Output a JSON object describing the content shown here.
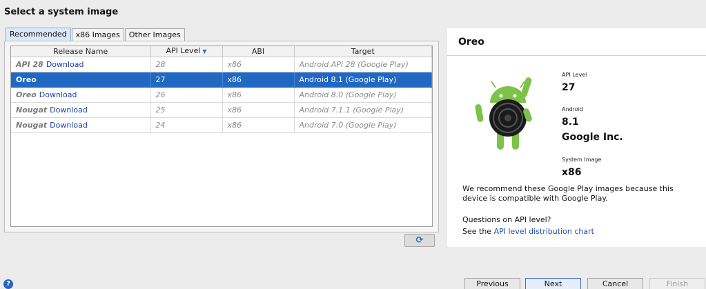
{
  "page": {
    "title": "Select a system image"
  },
  "tabs": [
    {
      "label": "Recommended",
      "active": true
    },
    {
      "label": "x86 Images",
      "active": false
    },
    {
      "label": "Other Images",
      "active": false
    }
  ],
  "table": {
    "columns": [
      "Release Name",
      "API Level",
      "ABI",
      "Target"
    ],
    "sorted_column": "API Level",
    "rows": [
      {
        "name": "API 28",
        "download": "Download",
        "api": "28",
        "abi": "x86",
        "target": "Android API 28 (Google Play)",
        "selected": false
      },
      {
        "name": "Oreo",
        "download": "",
        "api": "27",
        "abi": "x86",
        "target": "Android 8.1 (Google Play)",
        "selected": true
      },
      {
        "name": "Oreo",
        "download": "Download",
        "api": "26",
        "abi": "x86",
        "target": "Android 8.0 (Google Play)",
        "selected": false
      },
      {
        "name": "Nougat",
        "download": "Download",
        "api": "25",
        "abi": "x86",
        "target": "Android 7.1.1 (Google Play)",
        "selected": false
      },
      {
        "name": "Nougat",
        "download": "Download",
        "api": "24",
        "abi": "x86",
        "target": "Android 7.0 (Google Play)",
        "selected": false
      }
    ]
  },
  "details": {
    "title": "Oreo",
    "api_level_label": "API Level",
    "api_level": "27",
    "android_label": "Android",
    "android_version": "8.1",
    "vendor": "Google Inc.",
    "system_image_label": "System Image",
    "system_image": "x86",
    "recommend_text": "We recommend these Google Play images because this device is compatible with Google Play.",
    "questions": "Questions on API level?",
    "see_prefix": "See the ",
    "see_link": "API level distribution chart"
  },
  "buttons": {
    "previous": "Previous",
    "next": "Next",
    "cancel": "Cancel",
    "finish": "Finish"
  },
  "colors": {
    "selection": "#2168c2",
    "link": "#1a3fb0",
    "android_green": "#7cc24b"
  },
  "icons": {
    "refresh": "refresh-icon",
    "help": "help-icon",
    "sort": "sort-descending-icon"
  }
}
